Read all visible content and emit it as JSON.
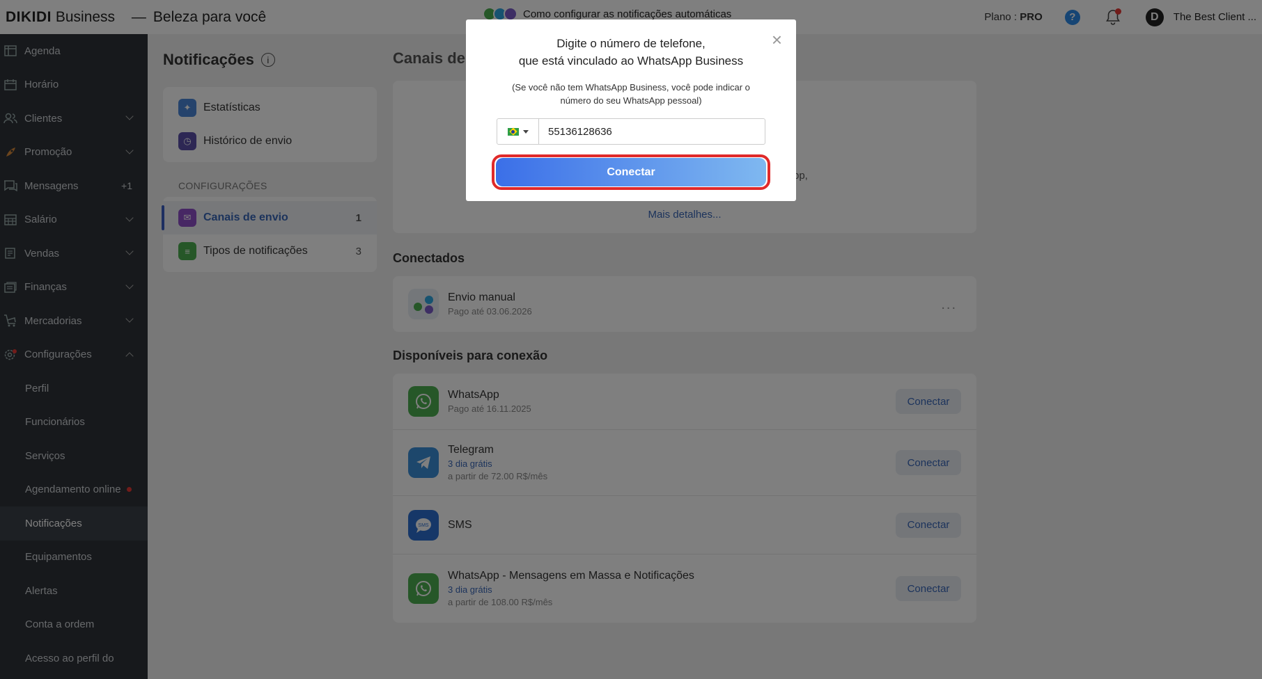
{
  "topbar": {
    "brand_name": "DIKIDI",
    "brand_suffix": "Business",
    "separator": "—",
    "business_name": "Beleza para você",
    "promo_text": "Como configurar as notificações automáticas",
    "plan_label": "Plano :",
    "plan_value": "PRO",
    "help_icon": "?",
    "avatar_letter": "D",
    "client_name": "The Best Client ..."
  },
  "sidebar": {
    "items": [
      {
        "label": "Agenda",
        "icon": "agenda-icon"
      },
      {
        "label": "Horário",
        "icon": "calendar-icon"
      },
      {
        "label": "Clientes",
        "icon": "users-icon"
      },
      {
        "label": "Promoção",
        "icon": "rocket-icon"
      },
      {
        "label": "Mensagens",
        "icon": "messages-icon",
        "badge": "+1"
      },
      {
        "label": "Salário",
        "icon": "salary-icon"
      },
      {
        "label": "Vendas",
        "icon": "sales-icon"
      },
      {
        "label": "Finanças",
        "icon": "finance-icon"
      },
      {
        "label": "Mercadorias",
        "icon": "cart-icon"
      },
      {
        "label": "Configurações",
        "icon": "gear-icon"
      }
    ],
    "sub": [
      "Perfil",
      "Funcionários",
      "Serviços",
      "Agendamento online",
      "Notificações",
      "Equipamentos",
      "Alertas",
      "Conta a ordem",
      "Acesso ao perfil do"
    ]
  },
  "subnav": {
    "title": "Notificações",
    "items": [
      {
        "label": "Estatísticas"
      },
      {
        "label": "Histórico de envio"
      }
    ],
    "section_label": "CONFIGURAÇÕES",
    "config": [
      {
        "label": "Canais de envio",
        "count": "1"
      },
      {
        "label": "Tipos de notificações",
        "count": "3"
      }
    ]
  },
  "content": {
    "title": "Canais de",
    "intro_tail": "pp,",
    "intro_link": "Mais detalhes...",
    "connected_title": "Conectados",
    "connected": {
      "title": "Envio manual",
      "sub": "Pago até 03.06.2026",
      "more": "..."
    },
    "available_title": "Disponíveis para conexão",
    "available": [
      {
        "title": "WhatsApp",
        "sub": "Pago até 16.11.2025",
        "button": "Conectar"
      },
      {
        "title": "Telegram",
        "trial": "3 dia grátis",
        "price": "a partir de 72.00 R$/mês",
        "button": "Conectar"
      },
      {
        "title": "SMS",
        "button": "Conectar"
      },
      {
        "title": "WhatsApp - Mensagens em Massa e Notificações",
        "trial": "3 dia grátis",
        "price": "a partir de 108.00 R$/mês",
        "button": "Conectar"
      }
    ]
  },
  "modal": {
    "title_line1": "Digite o número de telefone,",
    "title_line2": "que está vinculado ao WhatsApp Business",
    "note_line1": "(Se você não tem WhatsApp Business, você pode indicar o",
    "note_line2": "número do seu WhatsApp pessoal)",
    "phone_value": "55136128636",
    "close": "×",
    "button": "Conectar"
  }
}
